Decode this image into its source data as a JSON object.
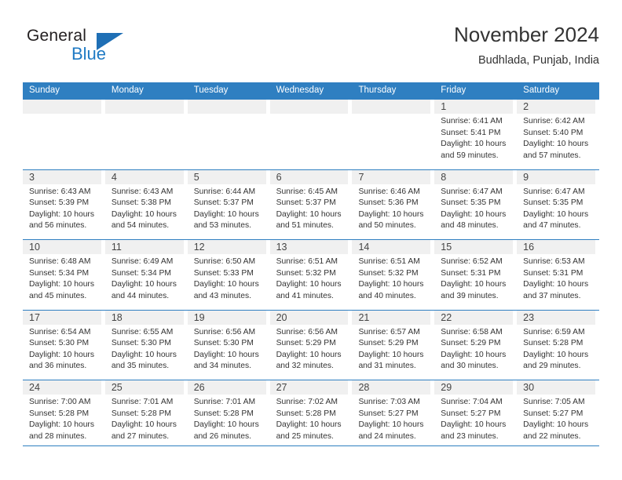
{
  "brand": {
    "name_part1": "General",
    "name_part2": "Blue",
    "triangle_icon": "triangle-icon",
    "accent_color": "#1f7ac4"
  },
  "header": {
    "title": "November 2024",
    "subtitle": "Budhlada, Punjab, India"
  },
  "theme": {
    "header_blue": "#2f7fc1",
    "day_band_gray": "#f0f0f0",
    "text_color": "#333333"
  },
  "weekdays": [
    "Sunday",
    "Monday",
    "Tuesday",
    "Wednesday",
    "Thursday",
    "Friday",
    "Saturday"
  ],
  "weeks": [
    [
      {
        "day": "",
        "sunrise": "",
        "sunset": "",
        "daylight1": "",
        "daylight2": ""
      },
      {
        "day": "",
        "sunrise": "",
        "sunset": "",
        "daylight1": "",
        "daylight2": ""
      },
      {
        "day": "",
        "sunrise": "",
        "sunset": "",
        "daylight1": "",
        "daylight2": ""
      },
      {
        "day": "",
        "sunrise": "",
        "sunset": "",
        "daylight1": "",
        "daylight2": ""
      },
      {
        "day": "",
        "sunrise": "",
        "sunset": "",
        "daylight1": "",
        "daylight2": ""
      },
      {
        "day": "1",
        "sunrise": "Sunrise: 6:41 AM",
        "sunset": "Sunset: 5:41 PM",
        "daylight1": "Daylight: 10 hours",
        "daylight2": "and 59 minutes."
      },
      {
        "day": "2",
        "sunrise": "Sunrise: 6:42 AM",
        "sunset": "Sunset: 5:40 PM",
        "daylight1": "Daylight: 10 hours",
        "daylight2": "and 57 minutes."
      }
    ],
    [
      {
        "day": "3",
        "sunrise": "Sunrise: 6:43 AM",
        "sunset": "Sunset: 5:39 PM",
        "daylight1": "Daylight: 10 hours",
        "daylight2": "and 56 minutes."
      },
      {
        "day": "4",
        "sunrise": "Sunrise: 6:43 AM",
        "sunset": "Sunset: 5:38 PM",
        "daylight1": "Daylight: 10 hours",
        "daylight2": "and 54 minutes."
      },
      {
        "day": "5",
        "sunrise": "Sunrise: 6:44 AM",
        "sunset": "Sunset: 5:37 PM",
        "daylight1": "Daylight: 10 hours",
        "daylight2": "and 53 minutes."
      },
      {
        "day": "6",
        "sunrise": "Sunrise: 6:45 AM",
        "sunset": "Sunset: 5:37 PM",
        "daylight1": "Daylight: 10 hours",
        "daylight2": "and 51 minutes."
      },
      {
        "day": "7",
        "sunrise": "Sunrise: 6:46 AM",
        "sunset": "Sunset: 5:36 PM",
        "daylight1": "Daylight: 10 hours",
        "daylight2": "and 50 minutes."
      },
      {
        "day": "8",
        "sunrise": "Sunrise: 6:47 AM",
        "sunset": "Sunset: 5:35 PM",
        "daylight1": "Daylight: 10 hours",
        "daylight2": "and 48 minutes."
      },
      {
        "day": "9",
        "sunrise": "Sunrise: 6:47 AM",
        "sunset": "Sunset: 5:35 PM",
        "daylight1": "Daylight: 10 hours",
        "daylight2": "and 47 minutes."
      }
    ],
    [
      {
        "day": "10",
        "sunrise": "Sunrise: 6:48 AM",
        "sunset": "Sunset: 5:34 PM",
        "daylight1": "Daylight: 10 hours",
        "daylight2": "and 45 minutes."
      },
      {
        "day": "11",
        "sunrise": "Sunrise: 6:49 AM",
        "sunset": "Sunset: 5:34 PM",
        "daylight1": "Daylight: 10 hours",
        "daylight2": "and 44 minutes."
      },
      {
        "day": "12",
        "sunrise": "Sunrise: 6:50 AM",
        "sunset": "Sunset: 5:33 PM",
        "daylight1": "Daylight: 10 hours",
        "daylight2": "and 43 minutes."
      },
      {
        "day": "13",
        "sunrise": "Sunrise: 6:51 AM",
        "sunset": "Sunset: 5:32 PM",
        "daylight1": "Daylight: 10 hours",
        "daylight2": "and 41 minutes."
      },
      {
        "day": "14",
        "sunrise": "Sunrise: 6:51 AM",
        "sunset": "Sunset: 5:32 PM",
        "daylight1": "Daylight: 10 hours",
        "daylight2": "and 40 minutes."
      },
      {
        "day": "15",
        "sunrise": "Sunrise: 6:52 AM",
        "sunset": "Sunset: 5:31 PM",
        "daylight1": "Daylight: 10 hours",
        "daylight2": "and 39 minutes."
      },
      {
        "day": "16",
        "sunrise": "Sunrise: 6:53 AM",
        "sunset": "Sunset: 5:31 PM",
        "daylight1": "Daylight: 10 hours",
        "daylight2": "and 37 minutes."
      }
    ],
    [
      {
        "day": "17",
        "sunrise": "Sunrise: 6:54 AM",
        "sunset": "Sunset: 5:30 PM",
        "daylight1": "Daylight: 10 hours",
        "daylight2": "and 36 minutes."
      },
      {
        "day": "18",
        "sunrise": "Sunrise: 6:55 AM",
        "sunset": "Sunset: 5:30 PM",
        "daylight1": "Daylight: 10 hours",
        "daylight2": "and 35 minutes."
      },
      {
        "day": "19",
        "sunrise": "Sunrise: 6:56 AM",
        "sunset": "Sunset: 5:30 PM",
        "daylight1": "Daylight: 10 hours",
        "daylight2": "and 34 minutes."
      },
      {
        "day": "20",
        "sunrise": "Sunrise: 6:56 AM",
        "sunset": "Sunset: 5:29 PM",
        "daylight1": "Daylight: 10 hours",
        "daylight2": "and 32 minutes."
      },
      {
        "day": "21",
        "sunrise": "Sunrise: 6:57 AM",
        "sunset": "Sunset: 5:29 PM",
        "daylight1": "Daylight: 10 hours",
        "daylight2": "and 31 minutes."
      },
      {
        "day": "22",
        "sunrise": "Sunrise: 6:58 AM",
        "sunset": "Sunset: 5:29 PM",
        "daylight1": "Daylight: 10 hours",
        "daylight2": "and 30 minutes."
      },
      {
        "day": "23",
        "sunrise": "Sunrise: 6:59 AM",
        "sunset": "Sunset: 5:28 PM",
        "daylight1": "Daylight: 10 hours",
        "daylight2": "and 29 minutes."
      }
    ],
    [
      {
        "day": "24",
        "sunrise": "Sunrise: 7:00 AM",
        "sunset": "Sunset: 5:28 PM",
        "daylight1": "Daylight: 10 hours",
        "daylight2": "and 28 minutes."
      },
      {
        "day": "25",
        "sunrise": "Sunrise: 7:01 AM",
        "sunset": "Sunset: 5:28 PM",
        "daylight1": "Daylight: 10 hours",
        "daylight2": "and 27 minutes."
      },
      {
        "day": "26",
        "sunrise": "Sunrise: 7:01 AM",
        "sunset": "Sunset: 5:28 PM",
        "daylight1": "Daylight: 10 hours",
        "daylight2": "and 26 minutes."
      },
      {
        "day": "27",
        "sunrise": "Sunrise: 7:02 AM",
        "sunset": "Sunset: 5:28 PM",
        "daylight1": "Daylight: 10 hours",
        "daylight2": "and 25 minutes."
      },
      {
        "day": "28",
        "sunrise": "Sunrise: 7:03 AM",
        "sunset": "Sunset: 5:27 PM",
        "daylight1": "Daylight: 10 hours",
        "daylight2": "and 24 minutes."
      },
      {
        "day": "29",
        "sunrise": "Sunrise: 7:04 AM",
        "sunset": "Sunset: 5:27 PM",
        "daylight1": "Daylight: 10 hours",
        "daylight2": "and 23 minutes."
      },
      {
        "day": "30",
        "sunrise": "Sunrise: 7:05 AM",
        "sunset": "Sunset: 5:27 PM",
        "daylight1": "Daylight: 10 hours",
        "daylight2": "and 22 minutes."
      }
    ]
  ]
}
